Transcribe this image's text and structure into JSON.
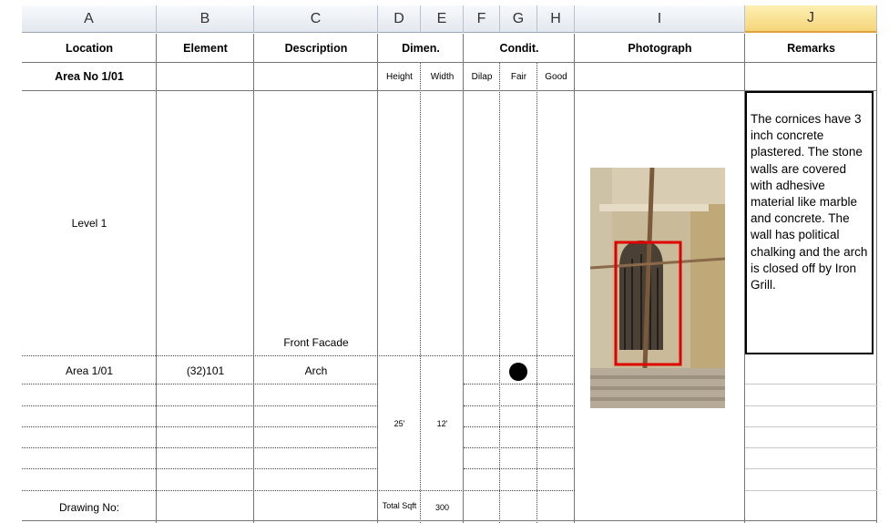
{
  "columns": [
    "A",
    "B",
    "C",
    "D",
    "E",
    "F",
    "G",
    "H",
    "I",
    "J"
  ],
  "selected_column": "J",
  "header": {
    "location": "Location",
    "element": "Element",
    "description": "Description",
    "dimen": "Dimen.",
    "condit": "Condit.",
    "photograph": "Photograph",
    "remarks": "Remarks"
  },
  "subheader": {
    "area": "Area No 1/01",
    "height": "Height",
    "width": "Width",
    "dilap": "Dilap",
    "fair": "Fair",
    "good": "Good"
  },
  "rows": {
    "level": "Level 1",
    "front_facade": "Front Facade",
    "area_location": "Area 1/01",
    "area_element": "(32)101",
    "area_description": "Arch",
    "height_value": "25'",
    "width_value": "12'",
    "drawing_no": "Drawing No:",
    "total_sqft_label": "Total Sqft",
    "total_sqft_value": "300"
  },
  "remarks_text": "The cornices have 3 inch concrete plastered. The stone walls are covered with adhesive material like marble and concrete. The wall has political chalking and the arch is closed off by Iron Grill.",
  "condition_mark": "Fair",
  "colors": {
    "header_bg": "#e3e8ef",
    "selected_header_bg": "#f5d57a",
    "highlight_rect": "#e00000"
  }
}
